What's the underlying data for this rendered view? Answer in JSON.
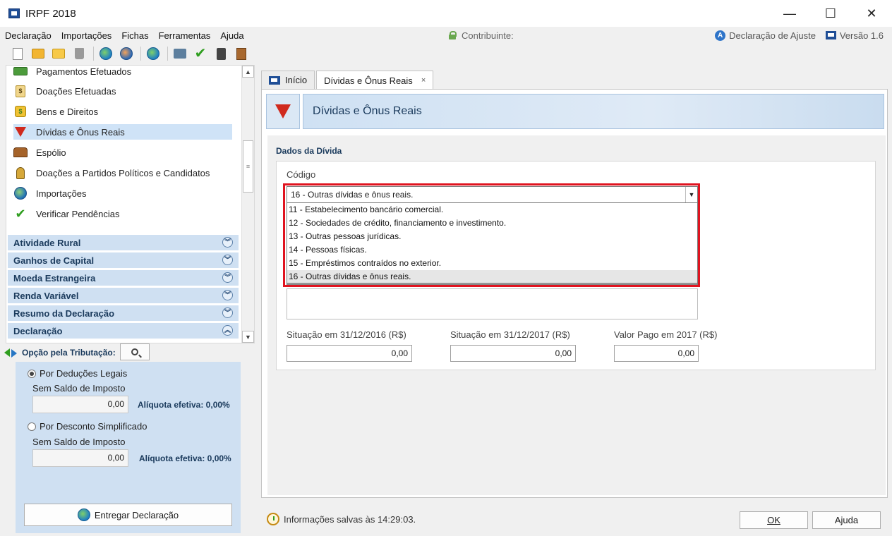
{
  "window": {
    "title": "IRPF 2018",
    "controls": [
      "—",
      "☐",
      "✕"
    ]
  },
  "menu": [
    "Declaração",
    "Importações",
    "Fichas",
    "Ferramentas",
    "Ajuda"
  ],
  "header_info": {
    "contribuinte": "Contribuinte:",
    "declaration_type": "Declaração de Ajuste",
    "version": "Versão 1.6"
  },
  "nav": {
    "items": [
      {
        "label": "Pagamentos Efetuados",
        "icon": "credit-card-icon"
      },
      {
        "label": "Doações Efetuadas",
        "icon": "money-jar-icon"
      },
      {
        "label": "Bens e Direitos",
        "icon": "money-bag-icon"
      },
      {
        "label": "Dívidas e Ônus Reais",
        "icon": "red-down-arrow-icon",
        "selected": true
      },
      {
        "label": "Espólio",
        "icon": "treasure-chest-icon"
      },
      {
        "label": "Doações a Partidos Políticos e Candidatos",
        "icon": "person-icon"
      },
      {
        "label": "Importações",
        "icon": "import-globe-icon"
      },
      {
        "label": "Verificar Pendências",
        "icon": "check-icon"
      }
    ],
    "sections": [
      {
        "label": "Atividade Rural",
        "state": "collapsed"
      },
      {
        "label": "Ganhos de Capital",
        "state": "collapsed"
      },
      {
        "label": "Moeda Estrangeira",
        "state": "collapsed"
      },
      {
        "label": "Renda Variável",
        "state": "collapsed"
      },
      {
        "label": "Resumo da Declaração",
        "state": "collapsed"
      },
      {
        "label": "Declaração",
        "state": "expanded"
      }
    ]
  },
  "tax_option": {
    "title": "Opção pela Tributação:",
    "legal": {
      "label": "Por Deduções Legais",
      "sublabel": "Sem Saldo de Imposto",
      "value": "0,00",
      "rate": "Alíquota efetiva: 0,00%",
      "checked": true
    },
    "simplified": {
      "label": "Por Desconto Simplificado",
      "sublabel": "Sem Saldo de Imposto",
      "value": "0,00",
      "rate": "Alíquota efetiva: 0,00%",
      "checked": false
    },
    "deliver_button": "Entregar Declaração"
  },
  "tabs": [
    {
      "label": "Início",
      "active": false
    },
    {
      "label": "Dívidas e Ônus Reais",
      "active": true,
      "close": "×"
    }
  ],
  "page": {
    "banner_title": "Dívidas e Ônus Reais",
    "section_title": "Dados da Dívida",
    "codigo_label": "Código",
    "codigo_selected": "16 - Outras dívidas e ônus reais.",
    "codigo_options": [
      "11 - Estabelecimento bancário comercial.",
      "12 - Sociedades de crédito, financiamento e investimento.",
      "13 - Outras pessoas jurídicas.",
      "14 - Pessoas físicas.",
      "15 - Empréstimos contraídos no exterior.",
      "16 - Outras dívidas e ônus reais."
    ],
    "selected_index": 5,
    "sit2016_label": "Situação em 31/12/2016 (R$)",
    "sit2016_value": "0,00",
    "sit2017_label": "Situação em 31/12/2017 (R$)",
    "sit2017_value": "0,00",
    "paid_label": "Valor Pago em 2017 (R$)",
    "paid_value": "0,00"
  },
  "status": {
    "text": "Informações salvas às 14:29:03."
  },
  "buttons": {
    "ok": "OK",
    "help": "Ajuda"
  },
  "colors": {
    "accent_blue": "#cfe0f2",
    "highlight_red": "#e0131f",
    "check_green": "#2f9e1f"
  }
}
